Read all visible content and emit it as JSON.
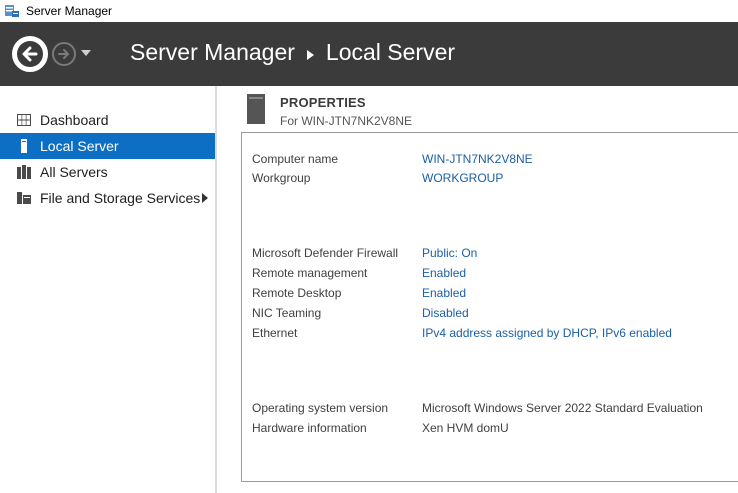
{
  "window": {
    "title": "Server Manager",
    "icon": "server-manager-icon"
  },
  "header": {
    "breadcrumb_root": "Server Manager",
    "breadcrumb_current": "Local Server",
    "background": "#3b3b3b"
  },
  "sidebar": {
    "items": [
      {
        "label": "Dashboard",
        "icon": "dashboard-grid-icon",
        "active": false
      },
      {
        "label": "Local Server",
        "icon": "single-server-icon",
        "active": true
      },
      {
        "label": "All Servers",
        "icon": "servers-icon",
        "active": false
      },
      {
        "label": "File and Storage Services",
        "icon": "file-storage-icon",
        "active": false,
        "has_children": true
      }
    ],
    "active_color": "#0d6fc4"
  },
  "properties": {
    "title": "PROPERTIES",
    "subtitle": "For WIN-JTN7NK2V8NE",
    "rows": [
      {
        "label": "Computer name",
        "value": "WIN-JTN7NK2V8NE",
        "link": true
      },
      {
        "label": "Workgroup",
        "value": "WORKGROUP",
        "link": true
      },
      {
        "label": "Microsoft Defender Firewall",
        "value": "Public: On",
        "link": true
      },
      {
        "label": "Remote management",
        "value": "Enabled",
        "link": true
      },
      {
        "label": "Remote Desktop",
        "value": "Enabled",
        "link": true
      },
      {
        "label": "NIC Teaming",
        "value": "Disabled",
        "link": true
      },
      {
        "label": "Ethernet",
        "value": "IPv4 address assigned by DHCP, IPv6 enabled",
        "link": true
      },
      {
        "label": "Operating system version",
        "value": "Microsoft Windows Server 2022 Standard Evaluation",
        "link": false
      },
      {
        "label": "Hardware information",
        "value": "Xen HVM domU",
        "link": false
      }
    ],
    "link_color": "#1a5fa8"
  }
}
